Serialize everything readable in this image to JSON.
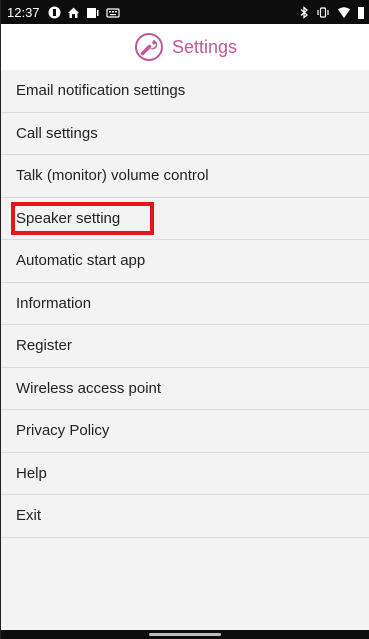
{
  "status_bar": {
    "time": "12:37",
    "left_icons": [
      "circle-app-icon",
      "home-app-icon",
      "media-icon",
      "keyboard-icon"
    ],
    "right_icons": [
      "bluetooth-icon",
      "vibrate-icon",
      "wifi-icon",
      "battery-icon"
    ]
  },
  "app_bar": {
    "title": "Settings",
    "icon": "wrench-icon",
    "accent_color": "#c0579a"
  },
  "menu": {
    "items": [
      {
        "label": "Email notification settings"
      },
      {
        "label": "Call settings"
      },
      {
        "label": "Talk (monitor) volume control"
      },
      {
        "label": "Speaker setting",
        "highlighted": true
      },
      {
        "label": "Automatic start app"
      },
      {
        "label": "Information"
      },
      {
        "label": "Register"
      },
      {
        "label": "Wireless access point"
      },
      {
        "label": "Privacy Policy"
      },
      {
        "label": "Help"
      },
      {
        "label": "Exit"
      }
    ],
    "highlight_color": "#e8141c"
  }
}
